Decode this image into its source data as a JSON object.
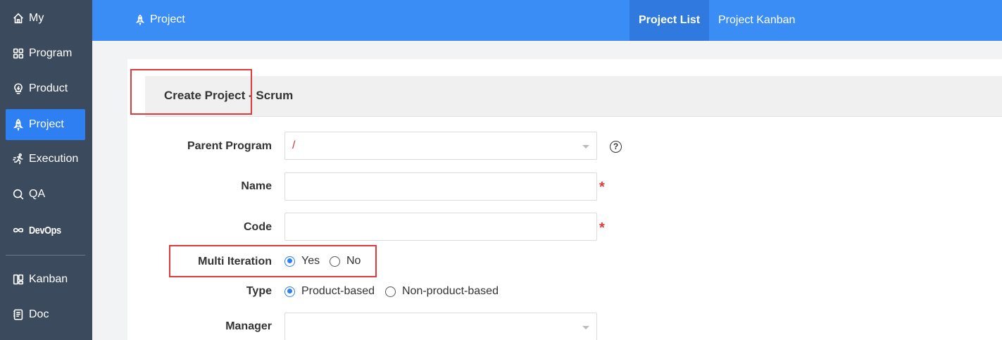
{
  "sidebar": {
    "items": [
      {
        "label": "My",
        "icon": "home-icon"
      },
      {
        "label": "Program",
        "icon": "grid-icon"
      },
      {
        "label": "Product",
        "icon": "lightbulb-icon"
      },
      {
        "label": "Project",
        "icon": "rocket-icon",
        "active": true
      },
      {
        "label": "Execution",
        "icon": "runner-icon"
      },
      {
        "label": "QA",
        "icon": "magnifier-icon"
      },
      {
        "label": "DevOps",
        "icon": "infinity-icon"
      },
      {
        "label": "Kanban",
        "icon": "kanban-icon"
      },
      {
        "label": "Doc",
        "icon": "doc-icon"
      }
    ]
  },
  "topbar": {
    "crumb": "Project",
    "tabs": [
      {
        "label": "Project List",
        "active": true
      },
      {
        "label": "Project Kanban",
        "active": false
      }
    ]
  },
  "form": {
    "title": "Create Project - Scrum",
    "parent_program": {
      "label": "Parent Program",
      "value": "/"
    },
    "name": {
      "label": "Name",
      "value": "",
      "required_mark": "*"
    },
    "code": {
      "label": "Code",
      "value": "",
      "required_mark": "*"
    },
    "multi_iteration": {
      "label": "Multi Iteration",
      "options": [
        "Yes",
        "No"
      ],
      "selected": "Yes"
    },
    "type": {
      "label": "Type",
      "options": [
        "Product-based",
        "Non-product-based"
      ],
      "selected": "Product-based"
    },
    "manager": {
      "label": "Manager",
      "value": ""
    },
    "help_glyph": "?"
  },
  "colors": {
    "sidebar_bg": "#3c4a5e",
    "topbar_bg": "#3b8df6",
    "accent": "#2e7ff2",
    "highlight": "#e03a3a"
  }
}
